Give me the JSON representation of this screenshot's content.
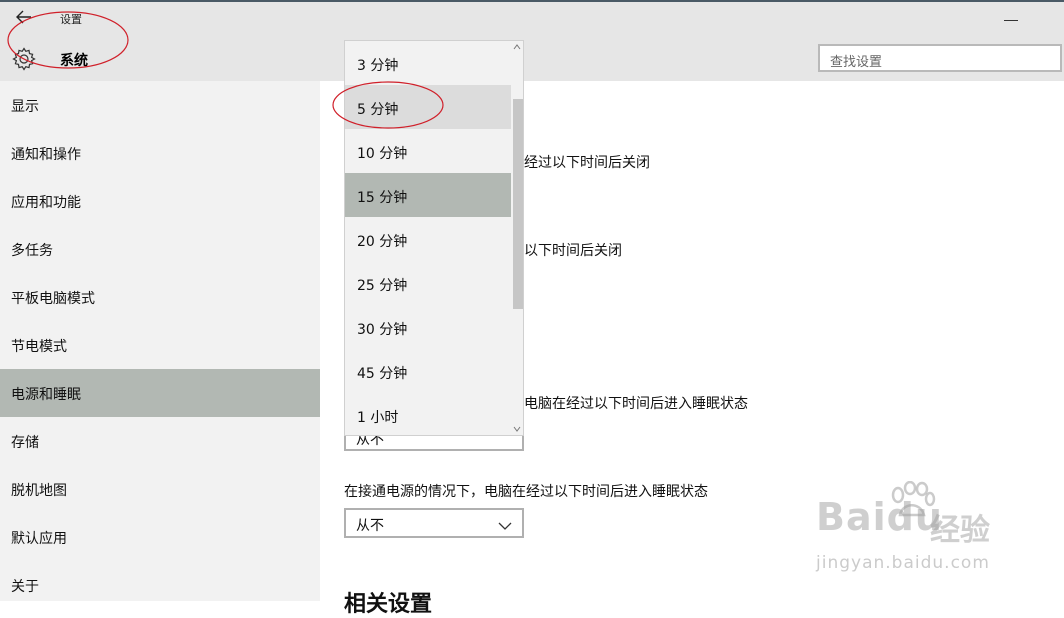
{
  "window": {
    "back_icon": "back-arrow-icon",
    "app_title": "设置",
    "section_icon": "gear-icon",
    "section_title": "系统",
    "minimize_icon": "minimize-icon"
  },
  "search": {
    "placeholder": "查找设置"
  },
  "sidebar": {
    "items": [
      {
        "label": "显示"
      },
      {
        "label": "通知和操作"
      },
      {
        "label": "应用和功能"
      },
      {
        "label": "多任务"
      },
      {
        "label": "平板电脑模式"
      },
      {
        "label": "节电模式"
      },
      {
        "label": "电源和睡眠",
        "selected": true
      },
      {
        "label": "存储"
      },
      {
        "label": "脱机地图"
      },
      {
        "label": "默认应用"
      },
      {
        "label": "关于"
      }
    ]
  },
  "content": {
    "screen_battery_tail": "经过以下时间后关闭",
    "screen_plugged_tail": "以下时间后关闭",
    "sleep_battery_tail": "电脑在经过以下时间后进入睡眠状态",
    "sleep_battery_value_partial": "从不",
    "sleep_plugged_label": "在接通电源的情况下，电脑在经过以下时间后进入睡眠状态",
    "sleep_plugged_value": "从不",
    "related_heading": "相关设置"
  },
  "dropdown": {
    "options": [
      {
        "label": "3 分钟"
      },
      {
        "label": "5 分钟",
        "state": "hover"
      },
      {
        "label": "10 分钟"
      },
      {
        "label": "15 分钟",
        "state": "selected"
      },
      {
        "label": "20 分钟"
      },
      {
        "label": "25 分钟"
      },
      {
        "label": "30 分钟"
      },
      {
        "label": "45 分钟"
      },
      {
        "label": "1 小时"
      }
    ]
  },
  "colors": {
    "header_bg": "#e6e6e6",
    "sidebar_bg": "#f2f2f2",
    "selected_bg": "#b2b8b3",
    "annotation_ellipse": "#d0202a"
  },
  "watermark": {
    "logo_text": "Baidu",
    "product_text": "经验",
    "url": "jingyan.baidu.com"
  }
}
